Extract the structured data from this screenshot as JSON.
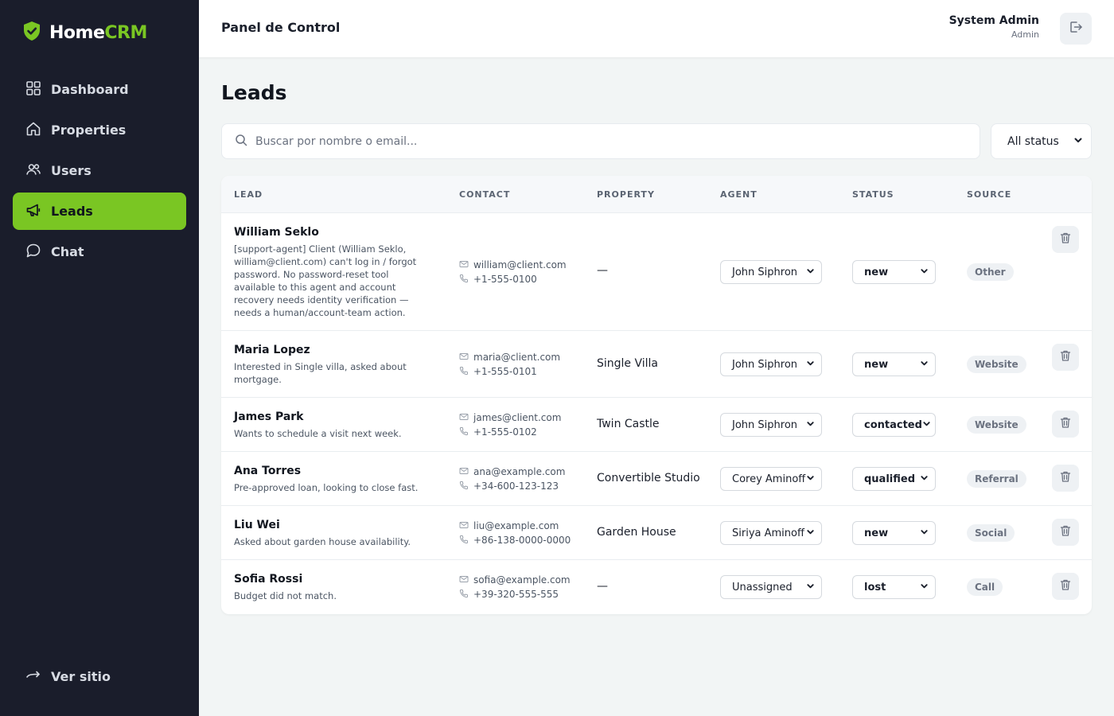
{
  "brand": {
    "name_part1": "Home",
    "name_part2": "CRM",
    "accent_color": "#7ac623"
  },
  "sidebar": {
    "items": [
      {
        "label": "Dashboard",
        "icon": "grid-icon",
        "active": false
      },
      {
        "label": "Properties",
        "icon": "home-icon",
        "active": false
      },
      {
        "label": "Users",
        "icon": "users-icon",
        "active": false
      },
      {
        "label": "Leads",
        "icon": "megaphone-icon",
        "active": true
      },
      {
        "label": "Chat",
        "icon": "chat-icon",
        "active": false
      }
    ],
    "footer_link": "Ver sitio"
  },
  "header": {
    "title": "Panel de Control",
    "user_name": "System Admin",
    "user_role": "Admin"
  },
  "main": {
    "title": "Leads",
    "search_placeholder": "Buscar por nombre o email...",
    "status_filter": "All status"
  },
  "table": {
    "columns": [
      "LEAD",
      "CONTACT",
      "PROPERTY",
      "AGENT",
      "STATUS",
      "SOURCE"
    ],
    "rows": [
      {
        "name": "William Seklo",
        "notes": "[support-agent] Client (William Seklo, william@client.com) can't log in / forgot password. No password-reset tool available to this agent and account recovery needs identity verification — needs a human/account-team action.",
        "email": "william@client.com",
        "phone": "+1-555-0100",
        "property": "—",
        "agent": "John Siphron",
        "status": "new",
        "source": "Other"
      },
      {
        "name": "Maria Lopez",
        "notes": "Interested in Single villa, asked about mortgage.",
        "email": "maria@client.com",
        "phone": "+1-555-0101",
        "property": "Single Villa",
        "agent": "John Siphron",
        "status": "new",
        "source": "Website"
      },
      {
        "name": "James Park",
        "notes": "Wants to schedule a visit next week.",
        "email": "james@client.com",
        "phone": "+1-555-0102",
        "property": "Twin Castle",
        "agent": "John Siphron",
        "status": "contacted",
        "source": "Website"
      },
      {
        "name": "Ana Torres",
        "notes": "Pre-approved loan, looking to close fast.",
        "email": "ana@example.com",
        "phone": "+34-600-123-123",
        "property": "Convertible Studio",
        "agent": "Corey Aminoff",
        "status": "qualified",
        "source": "Referral"
      },
      {
        "name": "Liu Wei",
        "notes": "Asked about garden house availability.",
        "email": "liu@example.com",
        "phone": "+86-138-0000-0000",
        "property": "Garden House",
        "agent": "Siriya Aminoff",
        "status": "new",
        "source": "Social"
      },
      {
        "name": "Sofia Rossi",
        "notes": "Budget did not match.",
        "email": "sofia@example.com",
        "phone": "+39-320-555-555",
        "property": "—",
        "agent": "Unassigned",
        "status": "lost",
        "source": "Call"
      }
    ]
  }
}
